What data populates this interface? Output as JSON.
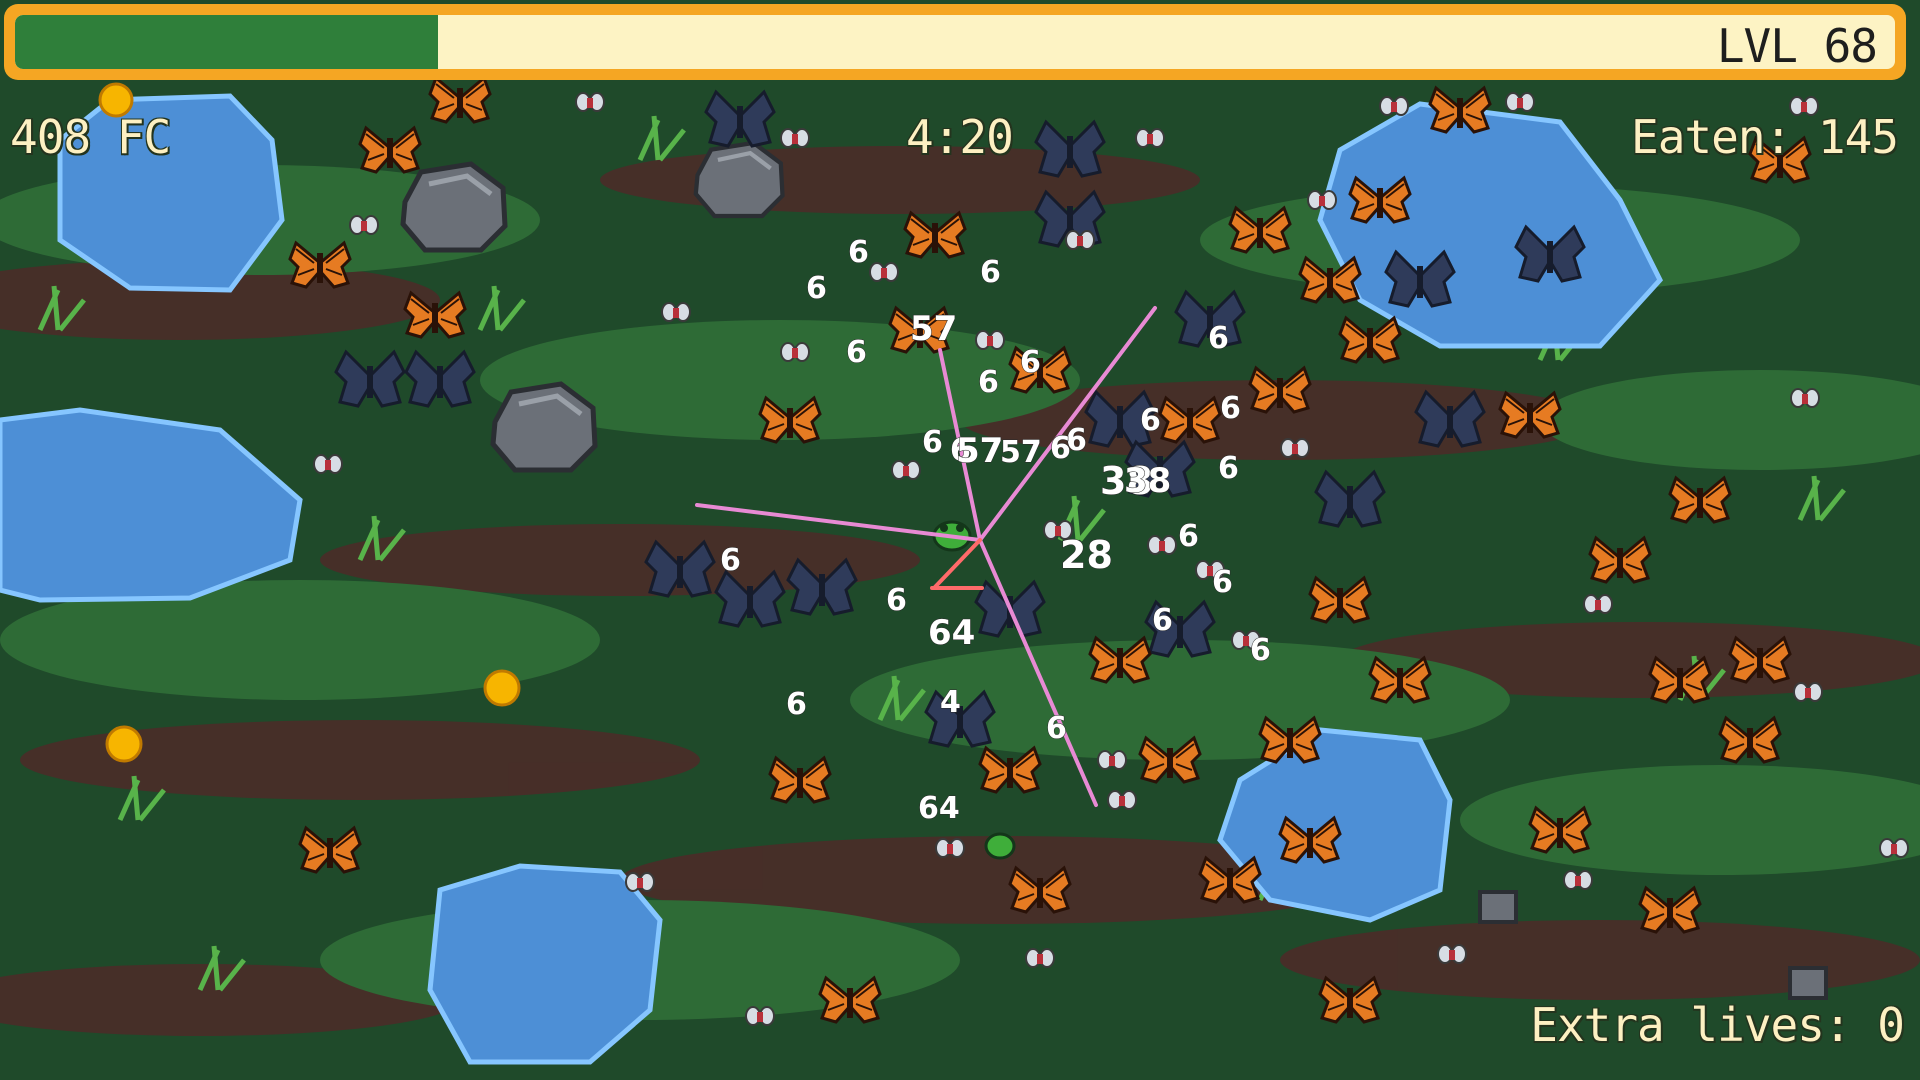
{
  "hud": {
    "xp_progress": 0.225,
    "level_label": "LVL 68",
    "currency": "408 FC",
    "timer": "4:20",
    "eaten": "Eaten: 145",
    "extra_lives": "Extra lives: 0"
  },
  "damage_numbers": [
    "6",
    "6",
    "6",
    "6",
    "57",
    "6",
    "6",
    "6",
    "6",
    "6",
    "6",
    "6",
    "6",
    "57",
    "57",
    "6",
    "6",
    "38",
    "38",
    "6",
    "28",
    "6",
    "6",
    "6",
    "64",
    "6",
    "6",
    "4",
    "6",
    "64",
    "6"
  ],
  "colors": {
    "grass_dark": "#1f4a2a",
    "grass_mid": "#2e6b36",
    "grass_light": "#3f8a3f",
    "dirt": "#5a2e2a",
    "water": "#4d8fd6",
    "water_edge": "#86c6ff",
    "rock": "#6b7078",
    "monarch_orange": "#e67b22",
    "dark_butterfly": "#2f3b5a",
    "xp_fill": "#2f7f3a",
    "xp_track": "#fdf3c4",
    "xp_frame": "#f5a623",
    "laser": "#e88ad4",
    "coin": "#f7b500"
  },
  "icons": {
    "player": "frog-icon",
    "enemy_a": "monarch-butterfly-icon",
    "enemy_b": "dark-moth-icon",
    "enemy_c": "fly-icon",
    "pickup": "coin-icon"
  }
}
